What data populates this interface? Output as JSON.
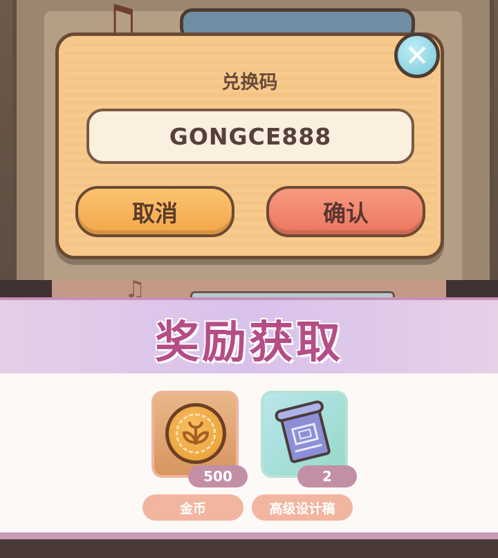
{
  "redeem_dialog": {
    "title": "兑换码",
    "code_value": "GONGCE888",
    "cancel_label": "取消",
    "confirm_label": "确认",
    "close_icon": "close-icon"
  },
  "reward_popup": {
    "title": "奖励获取",
    "rewards": [
      {
        "name": "金币",
        "count": "500",
        "icon": "gold-coin-icon"
      },
      {
        "name": "高级设计稿",
        "count": "2",
        "icon": "blueprint-scroll-icon"
      }
    ]
  },
  "colors": {
    "dialog_bg": "#f6c98a",
    "cancel_button": "#f3a64a",
    "confirm_button": "#ec7660",
    "reward_title": "#b54e86",
    "badge": "#c28fa6"
  }
}
